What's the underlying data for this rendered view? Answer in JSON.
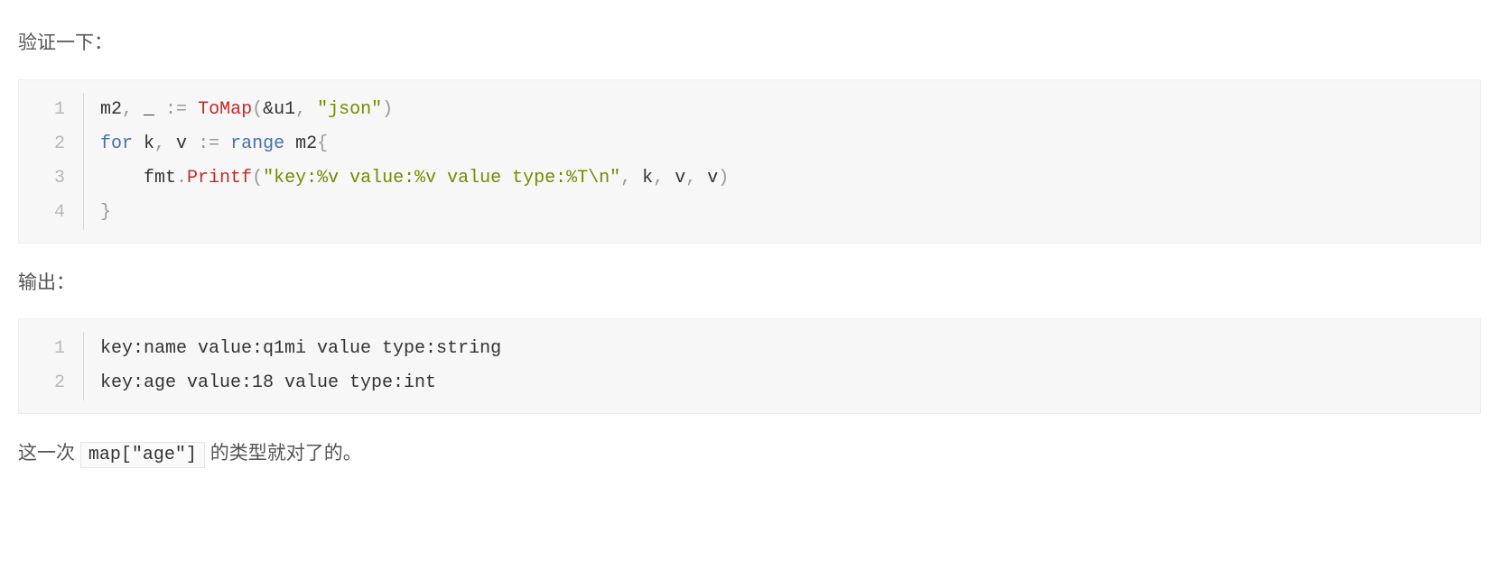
{
  "intro_text": "验证一下：",
  "code1": {
    "lineNumbers": [
      "1",
      "2",
      "3",
      "4"
    ],
    "l1": {
      "t1": "m2",
      "t2": ", ",
      "t3": "_",
      "t4": " := ",
      "t5": "ToMap",
      "t6": "(",
      "t7": "&u1",
      "t8": ", ",
      "t9": "\"json\"",
      "t10": ")"
    },
    "l2": {
      "t1": "for",
      "t2": " k",
      "t3": ", ",
      "t4": "v",
      "t5": " := ",
      "t6": "range",
      "t7": " m2",
      "t8": "{"
    },
    "l3": {
      "indent": "    ",
      "t1": "fmt",
      "t2": ".",
      "t3": "Printf",
      "t4": "(",
      "t5": "\"key:%v value:%v value type:%T\\n\"",
      "t6": ", ",
      "t7": "k",
      "t8": ", ",
      "t9": "v",
      "t10": ", ",
      "t11": "v",
      "t12": ")"
    },
    "l4": {
      "t1": "}"
    }
  },
  "output_label": "输出：",
  "code2": {
    "lineNumbers": [
      "1",
      "2"
    ],
    "lines": [
      "key:name value:q1mi value type:string",
      "key:age value:18 value type:int"
    ]
  },
  "final": {
    "before": "这一次 ",
    "code": "map[\"age\"]",
    "after": " 的类型就对了的。"
  }
}
